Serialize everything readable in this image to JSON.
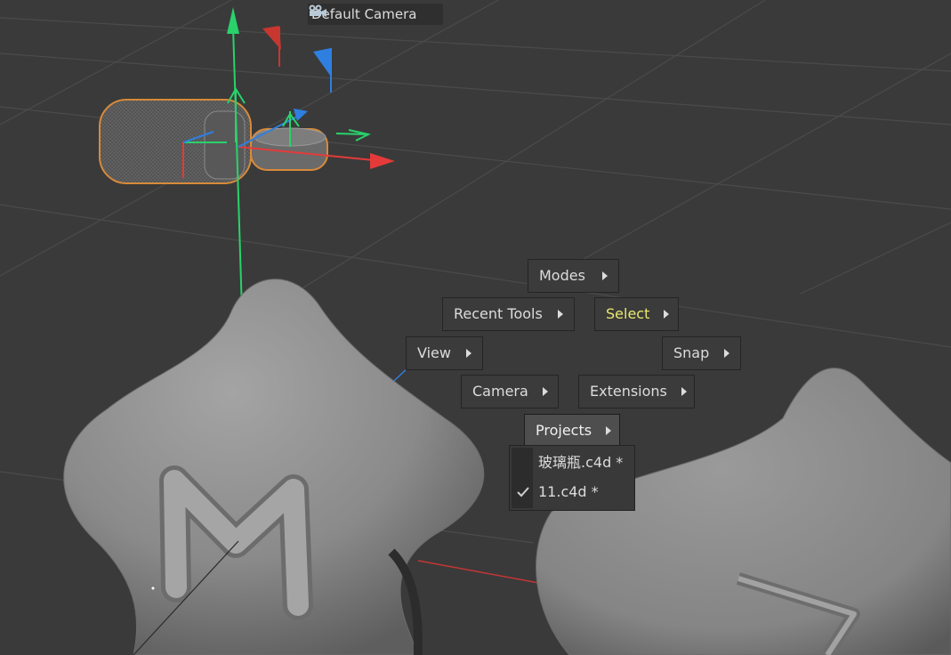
{
  "viewport": {
    "camera_label": "Default Camera",
    "camera_icon": "camera-icon",
    "colors": {
      "background": "#3a3a3a",
      "grid": "#4a4a4a",
      "axis_x": "#e53a3a",
      "axis_y": "#29d26b",
      "axis_z": "#2f7fe0",
      "selection_outline": "#d88a3a"
    }
  },
  "popup_menu": {
    "modes": "Modes",
    "recent_tools": "Recent Tools",
    "select": "Select",
    "view": "View",
    "snap": "Snap",
    "camera": "Camera",
    "extensions": "Extensions",
    "projects": "Projects",
    "highlight_color": "#e9e86f"
  },
  "projects_submenu": {
    "items": [
      {
        "label": "玻璃瓶.c4d *",
        "checked": false
      },
      {
        "label": "11.c4d *",
        "checked": true
      }
    ],
    "check_icon": "checkmark-icon"
  }
}
